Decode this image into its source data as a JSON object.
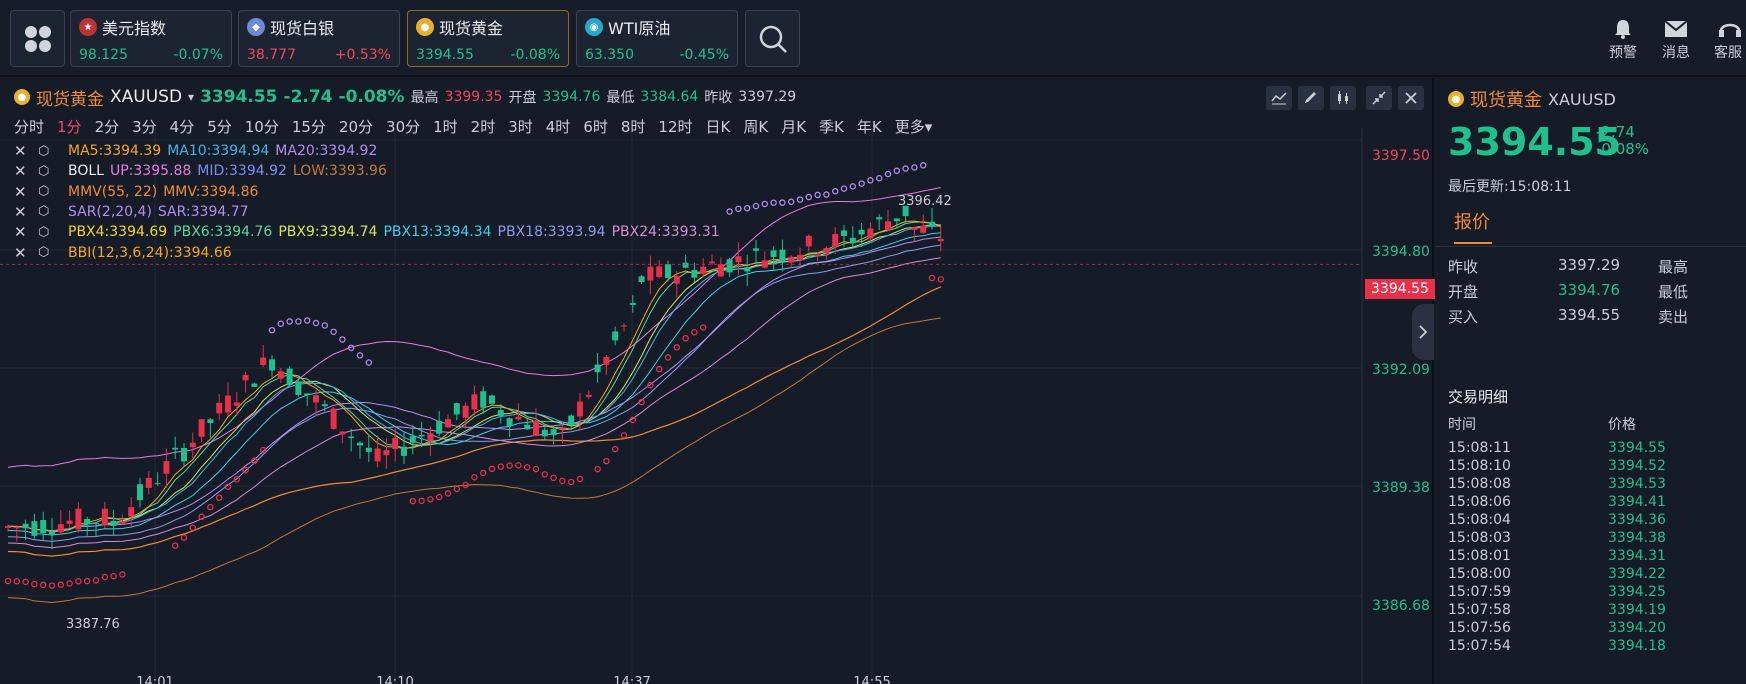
{
  "tickers": [
    {
      "name": "美元指数",
      "price": "98.125",
      "change": "-0.07%",
      "price_color": "#1fc08e",
      "change_color": "#1fc08e"
    },
    {
      "name": "现货白银",
      "price": "38.777",
      "change": "+0.53%",
      "price_color": "#f0475b",
      "change_color": "#f0475b"
    },
    {
      "name": "现货黄金",
      "price": "3394.55",
      "change": "-0.08%",
      "price_color": "#1fc08e",
      "change_color": "#1fc08e"
    },
    {
      "name": "WTI原油",
      "price": "63.350",
      "change": "-0.45%",
      "price_color": "#1fc08e",
      "change_color": "#1fc08e"
    }
  ],
  "top_actions": [
    "预警",
    "消息",
    "客服"
  ],
  "chart_header": {
    "name": "现货黄金",
    "symbol": "XAUUSD",
    "price": "3394.55",
    "change": "-2.74",
    "change_pct": "-0.08%",
    "high_label": "最高",
    "high": "3399.35",
    "open_label": "开盘",
    "open": "3394.76",
    "low_label": "最低",
    "low": "3384.64",
    "prev_label": "昨收",
    "prev": "3397.29"
  },
  "periods": [
    "分时",
    "1分",
    "2分",
    "3分",
    "4分",
    "5分",
    "10分",
    "15分",
    "20分",
    "30分",
    "1时",
    "2时",
    "3时",
    "4时",
    "6时",
    "8时",
    "12时",
    "日K",
    "周K",
    "月K",
    "季K",
    "年K",
    "更多▾"
  ],
  "selected_period": "1分",
  "indicators": [
    {
      "items": [
        {
          "t": "MA5:3394.39",
          "c": "#f5a623"
        },
        {
          "t": "MA10:3394.94",
          "c": "#3fb5e8"
        },
        {
          "t": "MA20:3394.92",
          "c": "#b48cf0"
        }
      ]
    },
    {
      "items": [
        {
          "t": "BOLL",
          "c": "#e8ebf0"
        },
        {
          "t": "UP:3395.88",
          "c": "#e87be0"
        },
        {
          "t": "MID:3394.92",
          "c": "#7b8cf0"
        },
        {
          "t": "LOW:3393.96",
          "c": "#c07a3a"
        }
      ]
    },
    {
      "items": [
        {
          "t": "MMV(55, 22)",
          "c": "#f08a3a"
        },
        {
          "t": "MMV:3394.86",
          "c": "#f08a3a"
        }
      ]
    },
    {
      "items": [
        {
          "t": "SAR(2,20,4)",
          "c": "#b48cf0"
        },
        {
          "t": "SAR:3394.77",
          "c": "#b48cf0"
        }
      ]
    },
    {
      "items": [
        {
          "t": "PBX4:3394.69",
          "c": "#f5d623"
        },
        {
          "t": "PBX6:3394.76",
          "c": "#5ad6a0"
        },
        {
          "t": "PBX9:3394.74",
          "c": "#d6e85a"
        },
        {
          "t": "PBX13:3394.34",
          "c": "#3fd0e8"
        },
        {
          "t": "PBX18:3393.94",
          "c": "#8c9cf0"
        },
        {
          "t": "PBX24:3393.31",
          "c": "#d68cd6"
        }
      ]
    },
    {
      "items": [
        {
          "t": "BBI(12,3,6,24):3394.66",
          "c": "#f5a623"
        }
      ]
    }
  ],
  "chart_data": {
    "type": "candlestick",
    "y_ticks": [
      "3397.50",
      "3394.80",
      "3392.09",
      "3389.38",
      "3386.68"
    ],
    "ylim": [
      3386.68,
      3397.5
    ],
    "x_ticks": [
      "14:01",
      "14:10",
      "14:37",
      "14:55"
    ],
    "current_price": "3394.55",
    "annotations": [
      "3396.42",
      "3387.76"
    ],
    "grid": true
  },
  "right_panel": {
    "name": "现货黄金",
    "symbol": "XAUUSD",
    "price": "3394.55",
    "change": "-2.74",
    "change_pct": "-0.08%",
    "updated": "最后更新:15:08:11",
    "tab": "报价",
    "quotes": [
      {
        "k": "昨收",
        "v": "3397.29",
        "c": "#c9ced8",
        "k2": "最高"
      },
      {
        "k": "开盘",
        "v": "3394.76",
        "c": "#1fc08e",
        "k2": "最低"
      },
      {
        "k": "买入",
        "v": "3394.55",
        "c": "#c9ced8",
        "k2": "卖出"
      }
    ],
    "trades_title": "交易明细",
    "trades_head": [
      "时间",
      "价格"
    ],
    "trades": [
      {
        "t": "15:08:11",
        "p": "3394.55"
      },
      {
        "t": "15:08:10",
        "p": "3394.52"
      },
      {
        "t": "15:08:08",
        "p": "3394.53"
      },
      {
        "t": "15:08:06",
        "p": "3394.41"
      },
      {
        "t": "15:08:04",
        "p": "3394.36"
      },
      {
        "t": "15:08:03",
        "p": "3394.38"
      },
      {
        "t": "15:08:01",
        "p": "3394.31"
      },
      {
        "t": "15:08:00",
        "p": "3394.22"
      },
      {
        "t": "15:07:59",
        "p": "3394.25"
      },
      {
        "t": "15:07:58",
        "p": "3394.19"
      },
      {
        "t": "15:07:56",
        "p": "3394.20"
      },
      {
        "t": "15:07:54",
        "p": "3394.18"
      }
    ]
  }
}
